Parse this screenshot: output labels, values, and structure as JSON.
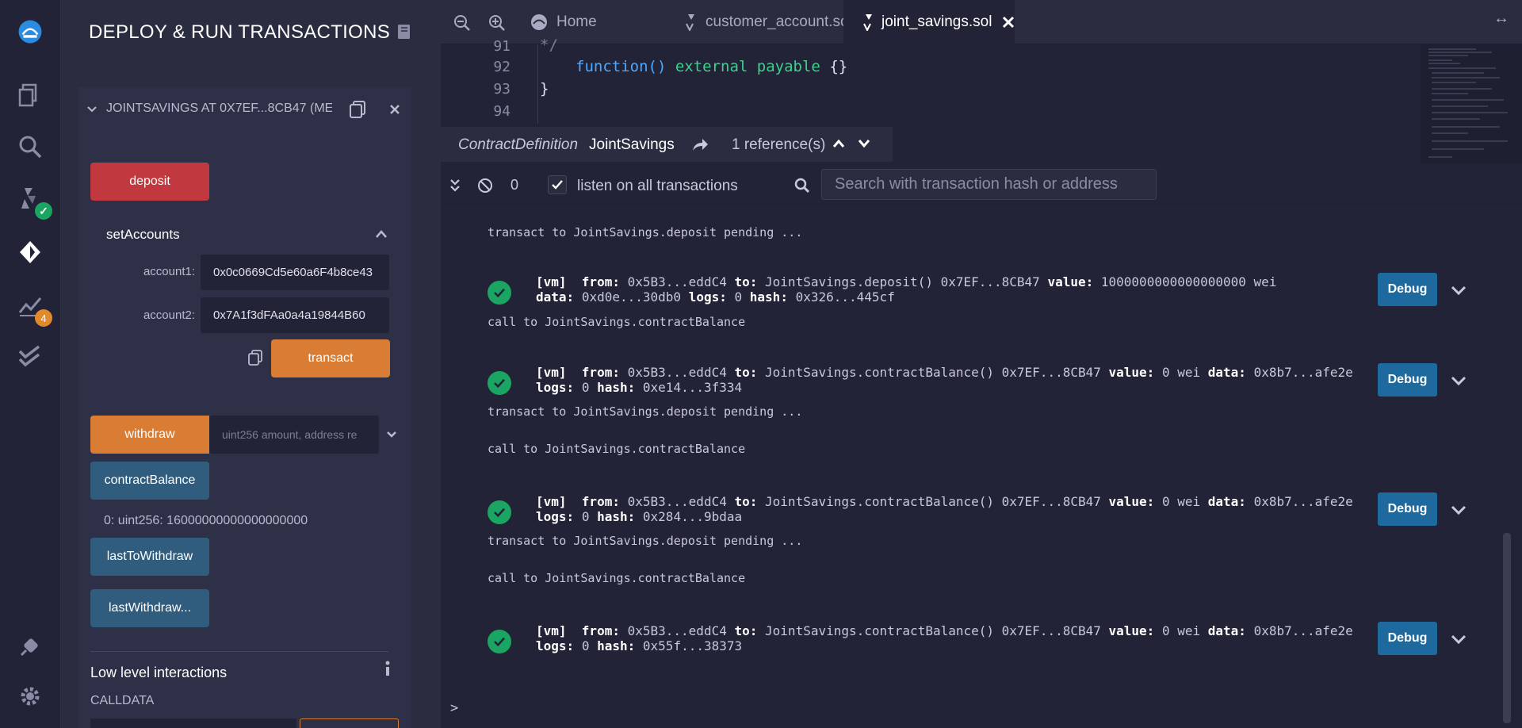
{
  "panel": {
    "title": "DEPLOY & RUN TRANSACTIONS",
    "contract_heading": "JOINTSAVINGS AT 0X7EF...8CB47 (ME",
    "deposit_label": "deposit",
    "set_accounts_label": "setAccounts",
    "account1_label": "account1:",
    "account1_value": "0x0c0669Cd5e60a6F4b8ce43",
    "account2_label": "account2:",
    "account2_value": "0x7A1f3dFAa0a4a19844B60",
    "transact_label": "transact",
    "withdraw_label": "withdraw",
    "withdraw_placeholder": "uint256 amount, address re",
    "contract_balance_label": "contractBalance",
    "contract_balance_result": "0: uint256: 16000000000000000000",
    "last_to_withdraw_label": "lastToWithdraw",
    "last_withdraw_label": "lastWithdraw...",
    "low_level_label": "Low level interactions",
    "calldata_label": "CALLDATA"
  },
  "iconbar": {
    "deploy_badge_count": "4"
  },
  "tabs": [
    {
      "label": "Home"
    },
    {
      "label": "customer_account.sol"
    },
    {
      "label": "joint_savings.sol"
    }
  ],
  "editor": {
    "lines": [
      {
        "num": "91",
        "text": "*/"
      },
      {
        "num": "92",
        "text": ""
      },
      {
        "num": "93",
        "text": "}"
      },
      {
        "num": "94",
        "text": ""
      }
    ],
    "function_kw": "function()",
    "external_payable": "external payable",
    "braces": "{}"
  },
  "definition": {
    "kind": "ContractDefinition",
    "name": "JointSavings",
    "references": "1 reference(s)"
  },
  "terminal": {
    "pending_count": "0",
    "listen_label": "listen on all transactions",
    "search_placeholder": "Search with transaction hash or address",
    "prompt": ">",
    "messages": {
      "m1": "transact to JointSavings.deposit pending ...",
      "m2": "call to JointSavings.contractBalance",
      "m3": "transact to JointSavings.deposit pending ...",
      "m4": "call to JointSavings.contractBalance",
      "m5": "transact to JointSavings.deposit pending ...",
      "m6": "call to JointSavings.contractBalance"
    },
    "tx": [
      {
        "vm": "[vm]",
        "from": "0x5B3...eddC4",
        "to": "JointSavings.deposit() 0x7EF...8CB47",
        "value": "1000000000000000000 wei",
        "data": "0xd0e...30db0",
        "logs": "0",
        "hash": "0x326...445cf"
      },
      {
        "vm": "[vm]",
        "from": "0x5B3...eddC4",
        "to": "JointSavings.contractBalance() 0x7EF...8CB47",
        "value": "0 wei",
        "data": "0x8b7...afe2e",
        "logs": "0",
        "hash": "0xe14...3f334"
      },
      {
        "vm": "[vm]",
        "from": "0x5B3...eddC4",
        "to": "JointSavings.contractBalance() 0x7EF...8CB47",
        "value": "0 wei",
        "data": "0x8b7...afe2e",
        "logs": "0",
        "hash": "0x284...9bdaa"
      },
      {
        "vm": "[vm]",
        "from": "0x5B3...eddC4",
        "to": "JointSavings.contractBalance() 0x7EF...8CB47",
        "value": "0 wei",
        "data": "0x8b7...afe2e",
        "logs": "0",
        "hash": "0x55f...38373"
      }
    ],
    "debug_label": "Debug"
  },
  "colors": {
    "deposit": "#c1393f",
    "transact": "#d97c34",
    "call": "#305c7d",
    "debug": "#1e6a9e",
    "success": "#1aa563"
  }
}
